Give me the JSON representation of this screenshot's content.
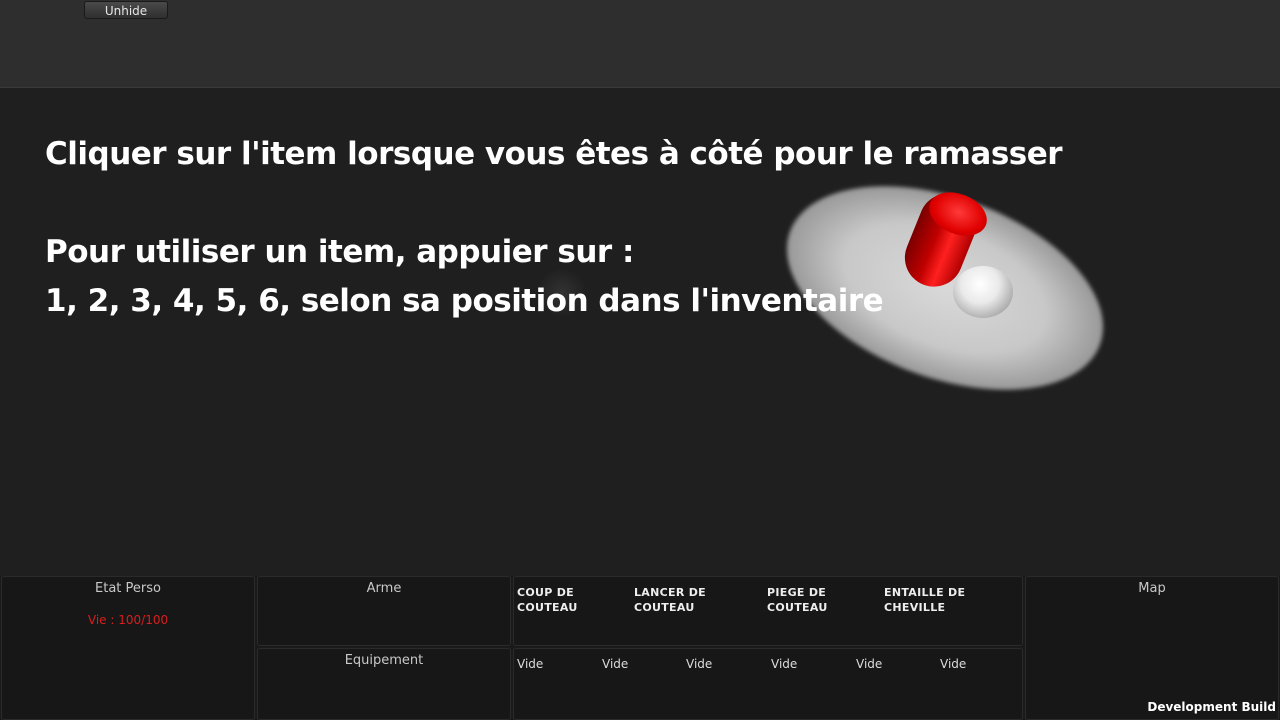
{
  "toolbar": {
    "unhide_label": "Unhide"
  },
  "instructions": {
    "line1": "Cliquer sur l'item lorsque vous êtes à côté pour le ramasser",
    "line2": "Pour utiliser un item, appuier sur :",
    "line3": "1, 2, 3, 4, 5, 6, selon sa position dans l'inventaire"
  },
  "hud": {
    "etat_perso": {
      "title": "Etat Perso",
      "life": "Vie : 100/100",
      "life_color": "#d81e1e"
    },
    "arme": {
      "title": "Arme"
    },
    "equipement": {
      "title": "Equipement"
    },
    "skills": [
      {
        "line1": "Coup de",
        "line2": "couteau"
      },
      {
        "line1": "Lancer de",
        "line2": "couteau"
      },
      {
        "line1": "Piege de",
        "line2": "couteau"
      },
      {
        "line1": "Entaille de",
        "line2": "cheville"
      }
    ],
    "inventory": [
      "Vide",
      "Vide",
      "Vide",
      "Vide",
      "Vide",
      "Vide"
    ],
    "map": {
      "title": "Map"
    }
  },
  "footer": {
    "dev_build": "Development Build"
  }
}
